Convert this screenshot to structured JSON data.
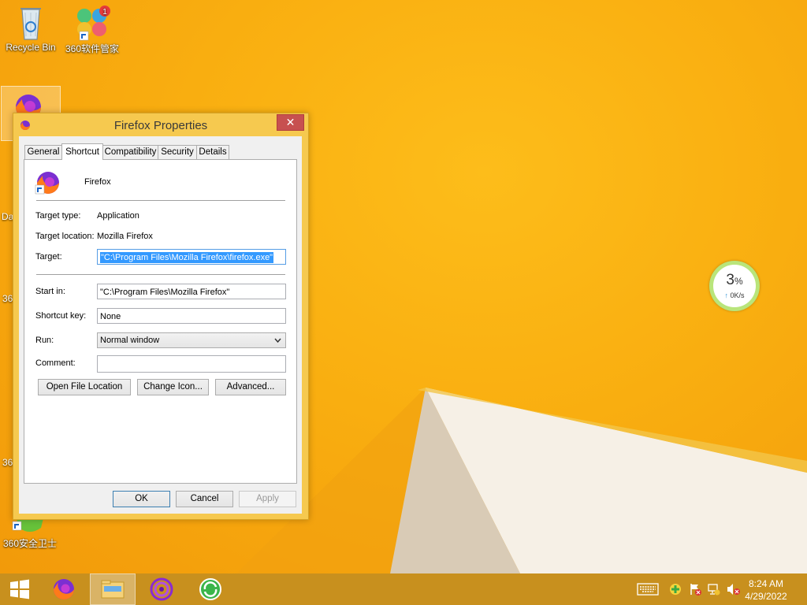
{
  "desktop": {
    "icons": [
      {
        "id": "recycle-bin",
        "label": "Recycle Bin"
      },
      {
        "id": "360-software-manager",
        "label": "360软件管家",
        "badge": "1"
      },
      {
        "id": "360-safe-guard",
        "label": "360安全卫士"
      }
    ],
    "partial_labels": [
      "Da",
      "36",
      "36"
    ]
  },
  "widget": {
    "percent": "3",
    "percent_unit": "%",
    "speed": "0K/s",
    "arrow": "↑"
  },
  "dialog": {
    "title": "Firefox Properties",
    "close_glyph": "✕",
    "tabs": [
      {
        "label": "General",
        "active": false
      },
      {
        "label": "Shortcut",
        "active": true
      },
      {
        "label": "Compatibility",
        "active": false
      },
      {
        "label": "Security",
        "active": false
      },
      {
        "label": "Details",
        "active": false
      }
    ],
    "shortcut_name": "Firefox",
    "target_type_label": "Target type:",
    "target_type_value": "Application",
    "target_location_label": "Target location:",
    "target_location_value": "Mozilla Firefox",
    "target_label": "Target:",
    "target_value": "\"C:\\Program Files\\Mozilla Firefox\\firefox.exe\"",
    "start_in_label": "Start in:",
    "start_in_value": "\"C:\\Program Files\\Mozilla Firefox\"",
    "shortcut_key_label": "Shortcut key:",
    "shortcut_key_value": "None",
    "run_label": "Run:",
    "run_value": "Normal window",
    "comment_label": "Comment:",
    "comment_value": "",
    "buttons": {
      "open_file_location": "Open File Location",
      "change_icon": "Change Icon...",
      "advanced": "Advanced..."
    },
    "footer": {
      "ok": "OK",
      "cancel": "Cancel",
      "apply": "Apply"
    }
  },
  "taskbar": {
    "clock_time": "8:24 AM",
    "clock_date": "4/29/2022",
    "apps": [
      "firefox",
      "file-explorer",
      "app-purple",
      "360-browser"
    ]
  },
  "colors": {
    "wallpaper": "#f9ae10",
    "taskbar": "#c8901e",
    "dialog_frame": "#f6c94f",
    "close_button": "#c75050",
    "selection": "#3399ff"
  }
}
